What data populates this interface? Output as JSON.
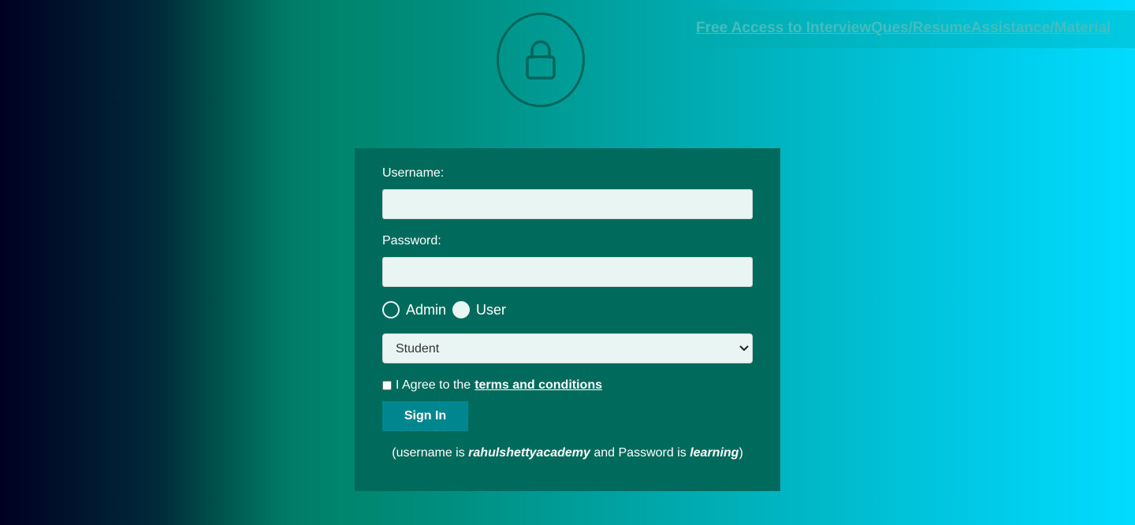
{
  "top_link": {
    "text": "Free Access to InterviewQues/ResumeAssistance/Material"
  },
  "header": {
    "icon": "lock-icon"
  },
  "form": {
    "username_label": "Username:",
    "username_value": "",
    "password_label": "Password:",
    "password_value": "",
    "role_options": {
      "admin": "Admin",
      "user": "User"
    },
    "selected_role": "admin",
    "dropdown_selected": "Student",
    "terms_prefix": "I Agree to the",
    "terms_link": "terms and conditions",
    "terms_checked": false,
    "signin_label": "Sign In",
    "hint": {
      "open": "(username is",
      "username": "rahulshettyacademy",
      "middle": "and Password is",
      "password": "learning",
      "close": ")"
    }
  },
  "colors": {
    "panel": "#006a5d",
    "button": "#00868f",
    "input_bg": "#e8f5f2",
    "link": "#45bdbf"
  }
}
